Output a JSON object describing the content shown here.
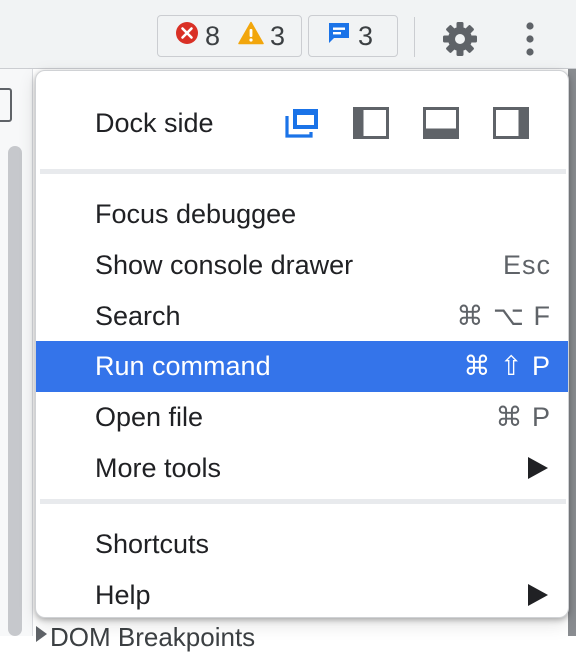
{
  "toolbar": {
    "errors_count": "8",
    "warnings_count": "3",
    "messages_count": "3"
  },
  "background": {
    "bottom_text": "DOM Breakpoints"
  },
  "menu": {
    "dock": {
      "label": "Dock side",
      "options": [
        "undock-icon",
        "dock-left-icon",
        "dock-bottom-icon",
        "dock-right-icon"
      ],
      "selected": "undock-icon"
    },
    "items": [
      {
        "label": "Focus debuggee",
        "shortcut": ""
      },
      {
        "label": "Show console drawer",
        "shortcut": "Esc"
      },
      {
        "label": "Search",
        "shortcut": "⌘ ⌥ F"
      },
      {
        "label": "Run command",
        "shortcut": "⌘ ⇧ P",
        "highlighted": true
      },
      {
        "label": "Open file",
        "shortcut": "⌘ P"
      },
      {
        "label": "More tools",
        "submenu": true
      }
    ],
    "footer_items": [
      {
        "label": "Shortcuts"
      },
      {
        "label": "Help",
        "submenu": true
      }
    ]
  },
  "colors": {
    "highlight": "#3474ea",
    "error": "#d93025",
    "warning": "#f2a60c",
    "info": "#1a73e8",
    "icon": "#5f6368"
  }
}
